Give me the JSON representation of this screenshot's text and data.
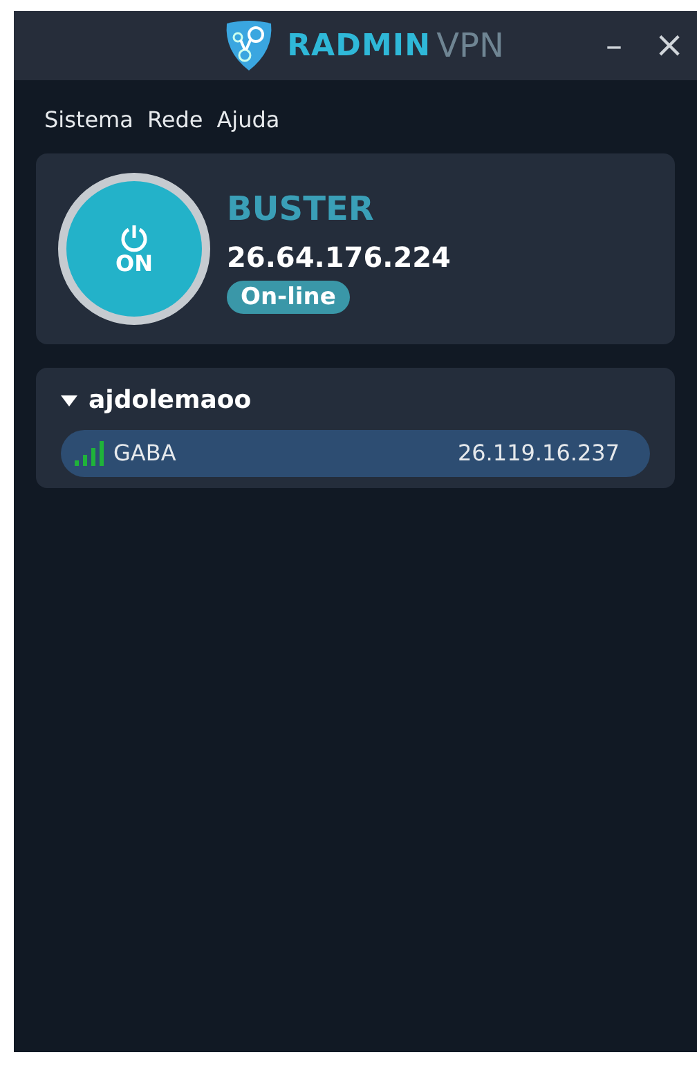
{
  "window": {
    "title_brand": "RADMIN",
    "title_product": "VPN",
    "controls": [
      "–",
      "×"
    ]
  },
  "menu": [
    "Sistema",
    "Rede",
    "Ajuda"
  ],
  "host": {
    "power_label": "ON",
    "on": true,
    "name": "BUSTER",
    "ip": "26.64.176.224",
    "status": "On-line"
  },
  "networks": [
    {
      "name": "ajdolemaoo",
      "expanded": true,
      "peers": [
        {
          "name": "GABA",
          "ip": "26.119.16.237",
          "selected": true
        }
      ]
    }
  ]
}
